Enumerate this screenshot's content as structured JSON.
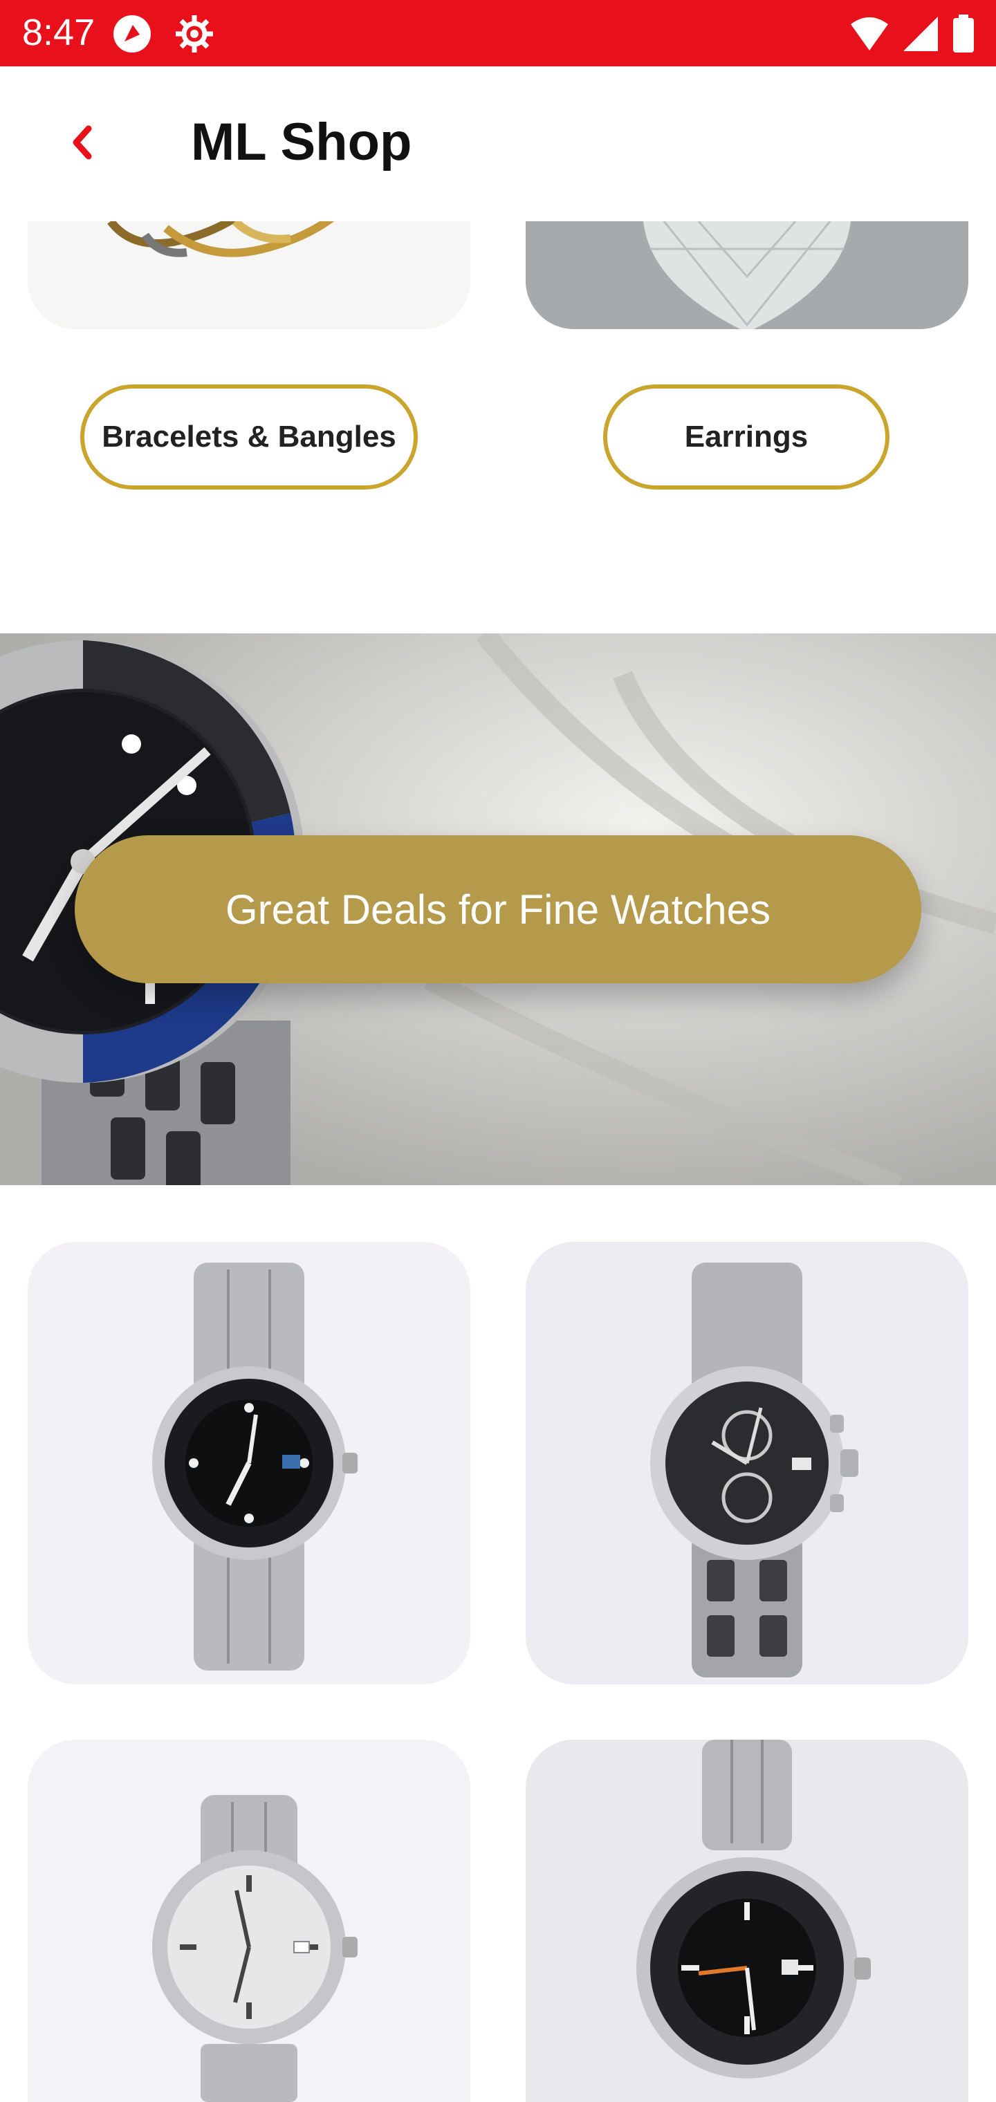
{
  "status_bar": {
    "time": "8:47",
    "icons": [
      "app-notification-icon",
      "settings-gear-icon",
      "wifi-icon",
      "signal-icon",
      "battery-icon"
    ]
  },
  "app_bar": {
    "title": "ML Shop",
    "back_icon": "chevron-left-icon"
  },
  "categories": [
    {
      "label": "Bracelets & Bangles"
    },
    {
      "label": "Earrings"
    }
  ],
  "banner": {
    "cta_label": "Great Deals for Fine Watches"
  },
  "products": [
    {
      "icon": "watch-icon"
    },
    {
      "icon": "watch-icon"
    },
    {
      "icon": "watch-icon"
    },
    {
      "icon": "watch-icon"
    }
  ],
  "colors": {
    "status_bar": "#e8101a",
    "accent_gold": "#c9a52e",
    "banner_button": "#b49a4a",
    "back_arrow": "#e8101a"
  }
}
